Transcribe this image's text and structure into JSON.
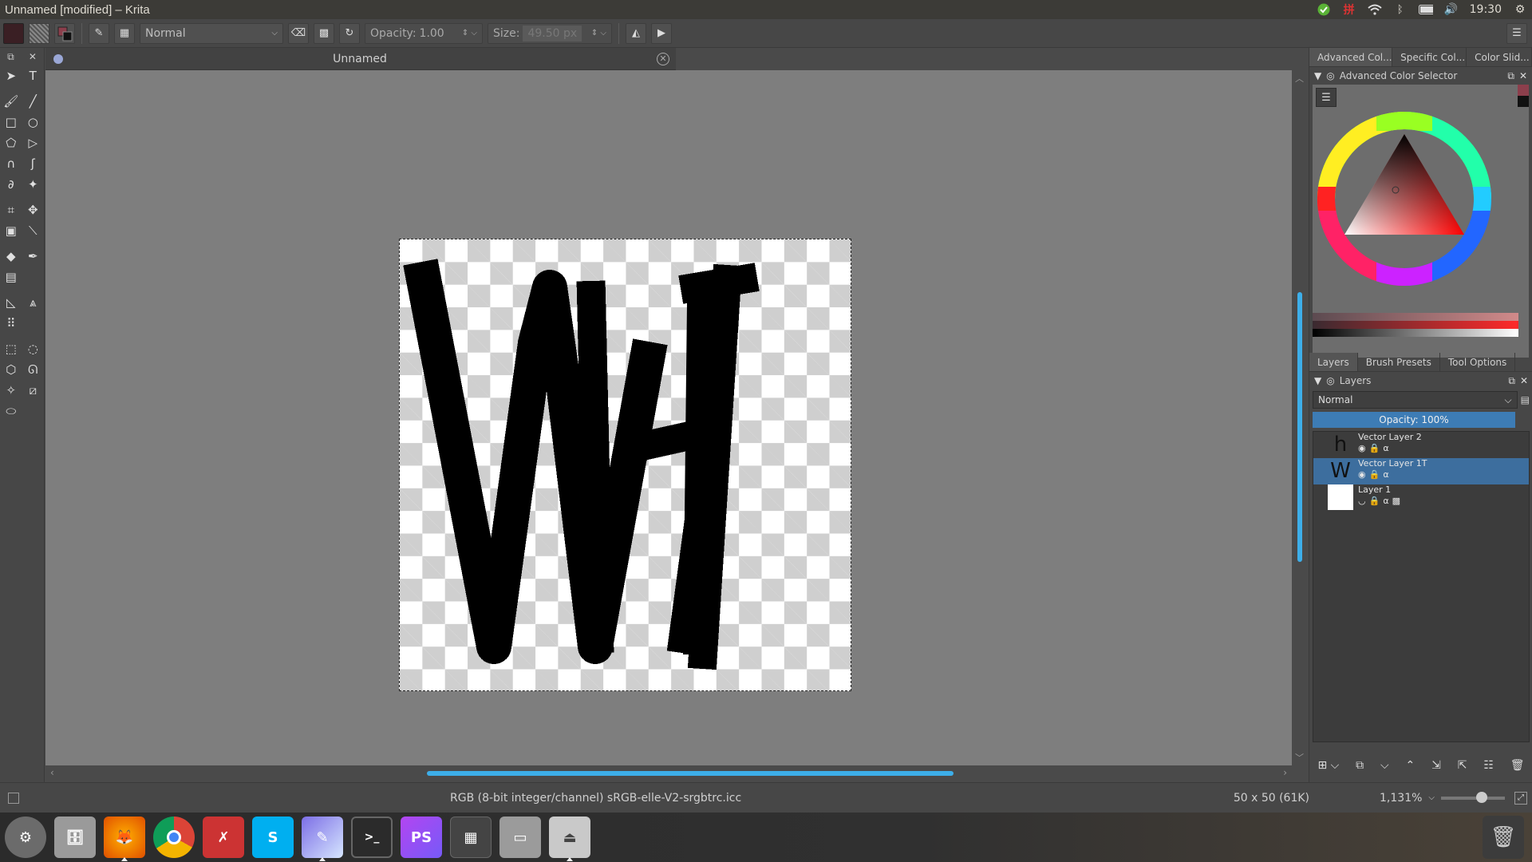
{
  "window": {
    "title": "Unnamed [modified] – Krita"
  },
  "tray": {
    "time": "19:30",
    "icons": [
      "check-icon",
      "input-method-icon",
      "wifi-icon",
      "bluetooth-icon",
      "battery-icon",
      "volume-icon",
      "gear-icon"
    ]
  },
  "toolbar": {
    "blend_mode": "Normal",
    "opacity_label": "Opacity:",
    "opacity_value": "1.00",
    "size_label": "Size:",
    "size_value": "49.50 px"
  },
  "document": {
    "tab_title": "Unnamed"
  },
  "docker": {
    "color_tabs": [
      "Advanced Col...",
      "Specific Col...",
      "Color Slid..."
    ],
    "color_title": "Advanced Color Selector",
    "colors": {
      "foreground": "#8c3f4c",
      "background": "#111111"
    },
    "layer_tabs": [
      "Layers",
      "Brush Presets",
      "Tool Options"
    ],
    "layers_title": "Layers",
    "layers_blend": "Normal",
    "layers_opacity": "Opacity:  100%",
    "layers": [
      {
        "name": "Vector Layer 2",
        "thumb": "h",
        "selected": false
      },
      {
        "name": "Vector Layer 1T",
        "thumb": "W",
        "selected": true
      },
      {
        "name": "Layer 1",
        "thumb": "",
        "selected": false
      }
    ]
  },
  "status": {
    "color_profile": "RGB (8-bit integer/channel)  sRGB-elle-V2-srgbtrc.icc",
    "image_size": "50 x 50 (61K)",
    "zoom": "1,131%"
  },
  "taskbar": {
    "apps": [
      "System Settings",
      "Files",
      "Firefox",
      "Chrome",
      "Tools",
      "Skype",
      "Krita",
      "Terminal",
      "PhpStorm",
      "Workspace",
      "Drive",
      "USB"
    ]
  },
  "accent": "#3daee9"
}
